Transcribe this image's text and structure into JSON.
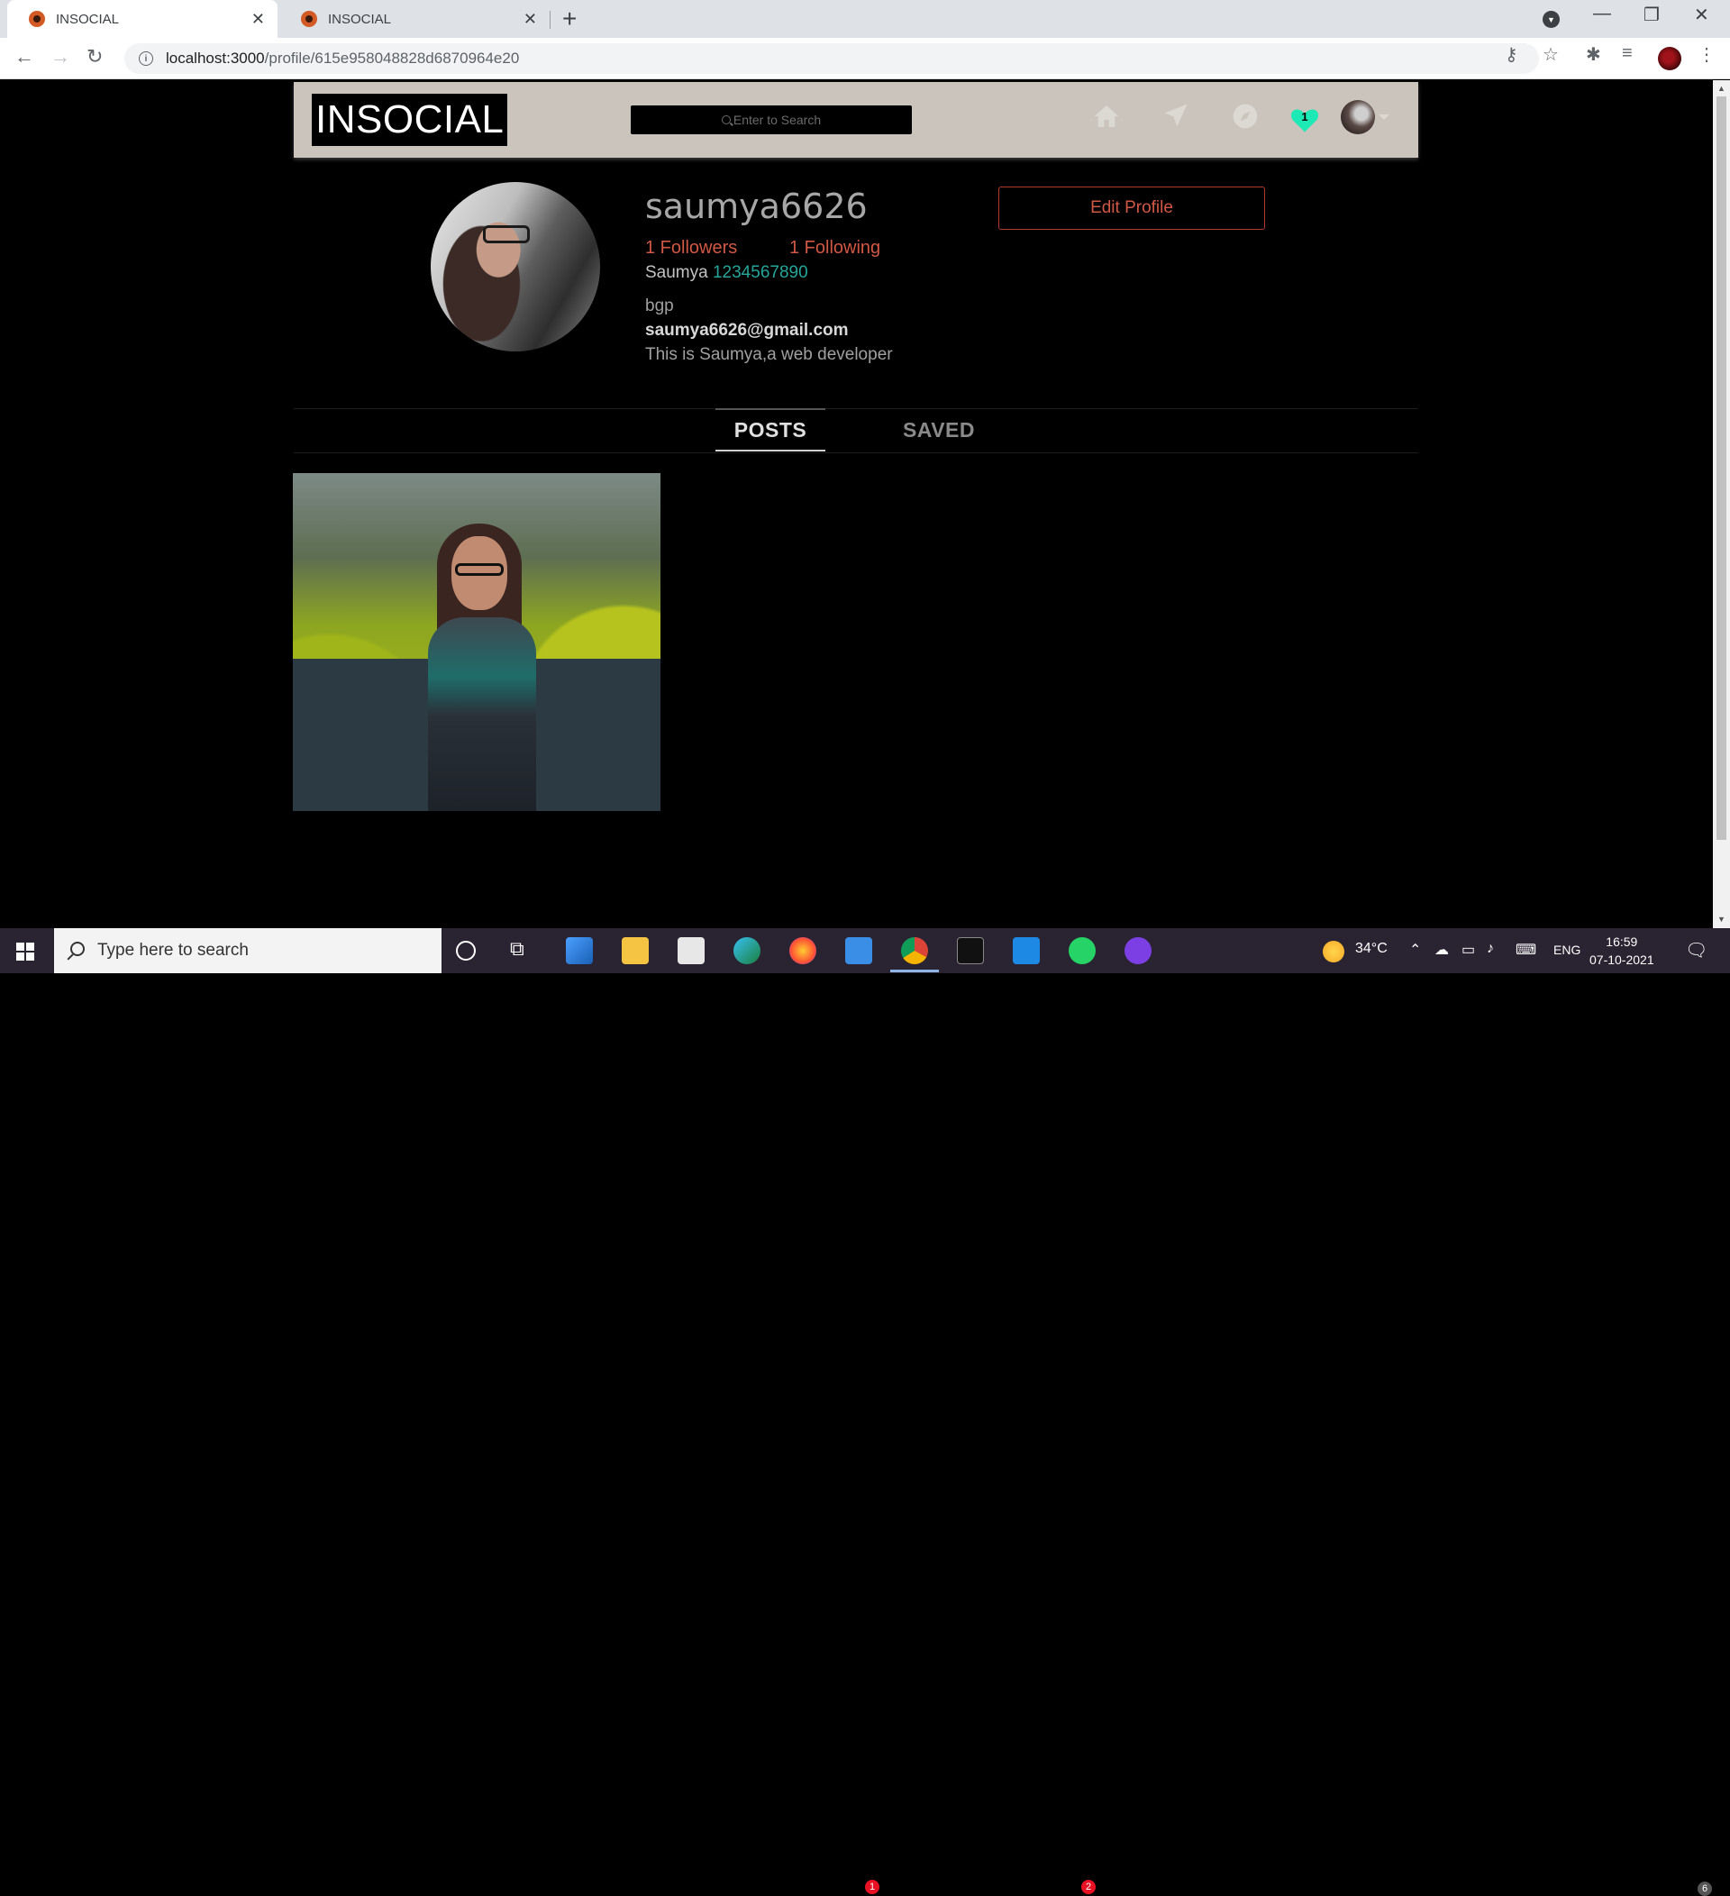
{
  "browser": {
    "tabs": [
      {
        "title": "INSOCIAL",
        "active": true
      },
      {
        "title": "INSOCIAL",
        "active": false
      }
    ],
    "url_host": "localhost:3000",
    "url_path": "/profile/615e958048828d6870964e20"
  },
  "app": {
    "brand": "INSOCIAL",
    "search_placeholder": "Enter to Search",
    "notification_count": "1",
    "accent_color": "#d15845",
    "heart_color": "#1de9b6",
    "nav_icons": [
      "home-icon",
      "send-icon",
      "explore-icon",
      "heart-icon",
      "avatar"
    ]
  },
  "profile": {
    "username": "saumya6626",
    "followers": "1 Followers",
    "following": "1 Following",
    "name": "Saumya",
    "phone": "1234567890",
    "city": "bgp",
    "email": "saumya6626@gmail.com",
    "bio": "This is Saumya,a web developer",
    "edit_label": "Edit Profile"
  },
  "tabs": {
    "posts": "POSTS",
    "saved": "SAVED",
    "active": "POSTS"
  },
  "posts": [
    {
      "type": "photo"
    }
  ],
  "taskbar": {
    "search_placeholder": "Type here to search",
    "weather": "34°C",
    "language": "ENG",
    "time": "16:59",
    "date": "07-10-2021",
    "mail_badge": "1",
    "whatsapp_badge": "2",
    "notifications_badge": "6"
  }
}
